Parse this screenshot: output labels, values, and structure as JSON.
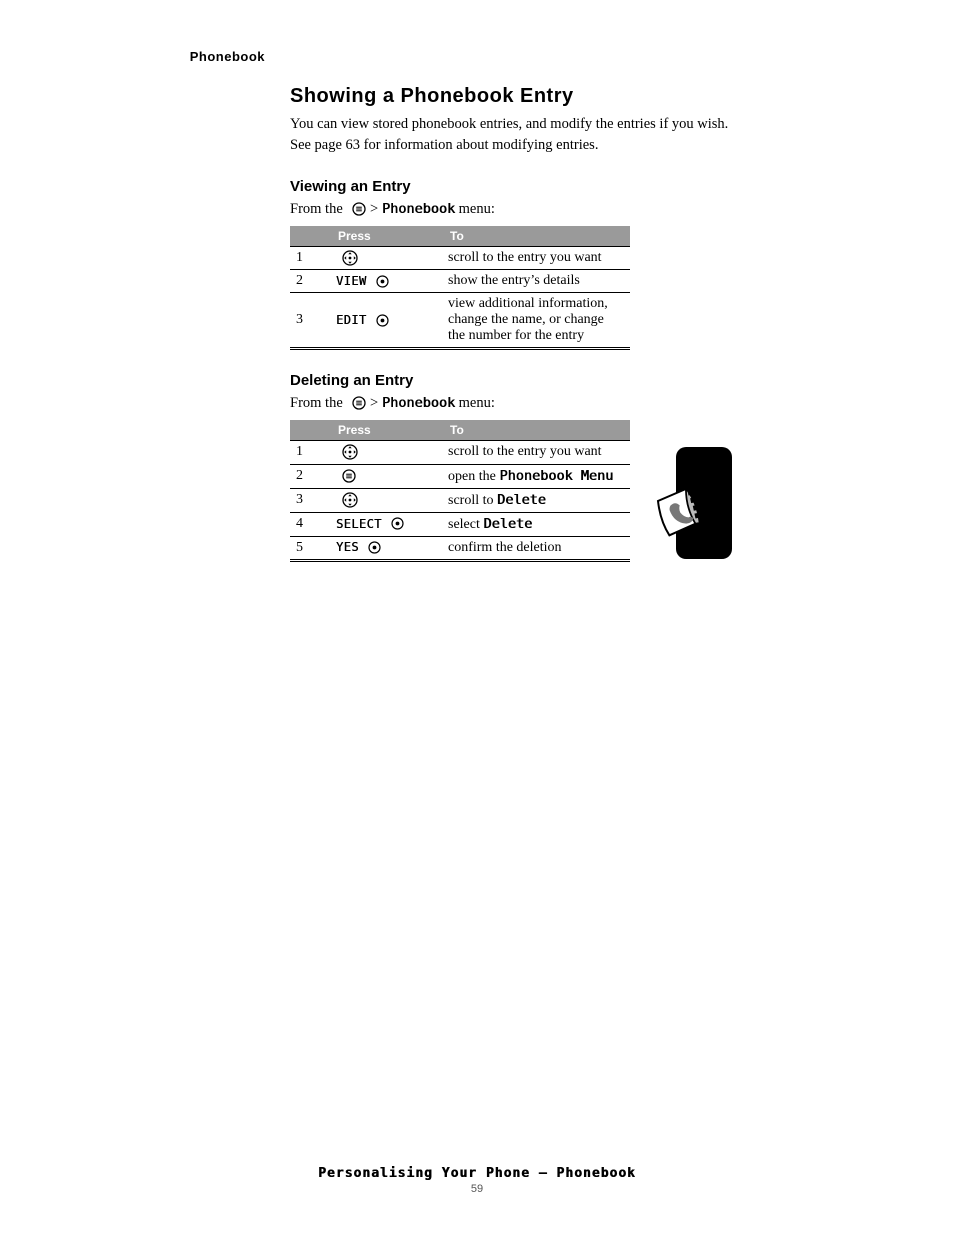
{
  "running_head": "Phonebook",
  "h2": "Showing a Phonebook Entry",
  "intro": "You can view stored phonebook entries, and modify the entries if you wish. See page 63 for information about modifying entries.",
  "h3_1": "Viewing an Entry",
  "lead_prefix": "From the ",
  "lead_suffix": " menu:",
  "table1": {
    "headers": [
      "",
      "Press",
      "To"
    ],
    "rows": [
      {
        "n": "1",
        "press_icon": "dpad",
        "to": "scroll to the entry you want"
      },
      {
        "n": "2",
        "press_label": "VIEW",
        "press_icon": "dot",
        "to": "show the entry’s details"
      },
      {
        "n": "3",
        "press_label": "EDIT",
        "press_icon": "dot",
        "to": "view additional information, change the name, or change the number for the entry"
      }
    ]
  },
  "h3_2": "Deleting an Entry",
  "table2": {
    "headers": [
      "",
      "Press",
      "To"
    ],
    "rows": [
      {
        "n": "1",
        "press_icon": "dpad",
        "to": "scroll to the entry you want"
      },
      {
        "n": "2",
        "press_icon": "menu",
        "to_prefix": "open the ",
        "to_label": "Phonebook Menu"
      },
      {
        "n": "3",
        "press_icon": "dpad",
        "to_prefix": "scroll to ",
        "to_label": "Delete"
      },
      {
        "n": "4",
        "press_label": "SELECT",
        "press_icon": "dot",
        "to_prefix": "select ",
        "to_label": "Delete"
      },
      {
        "n": "5",
        "press_label": "YES",
        "press_icon": "dot",
        "to": "confirm the deletion"
      }
    ]
  },
  "phonebook_label": "Phonebook",
  "footer_line": "Personalising Your Phone — Phonebook",
  "footer_page": "59"
}
